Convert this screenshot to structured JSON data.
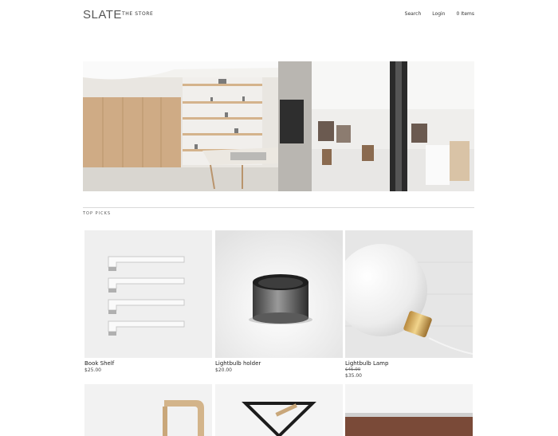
{
  "header": {
    "logo": "SLATE",
    "store": "THE STORE",
    "nav": {
      "search": "Search",
      "login": "Login",
      "cart": "0 Items"
    }
  },
  "section": {
    "title": "TOP PICKS"
  },
  "products": [
    {
      "name": "Book Shelf",
      "price": "$25.00"
    },
    {
      "name": "Lightbulb holder",
      "price": "$20.00"
    },
    {
      "name": "Lightbulb Lamp",
      "old_price": "$45.00",
      "price": "$35.00"
    }
  ]
}
